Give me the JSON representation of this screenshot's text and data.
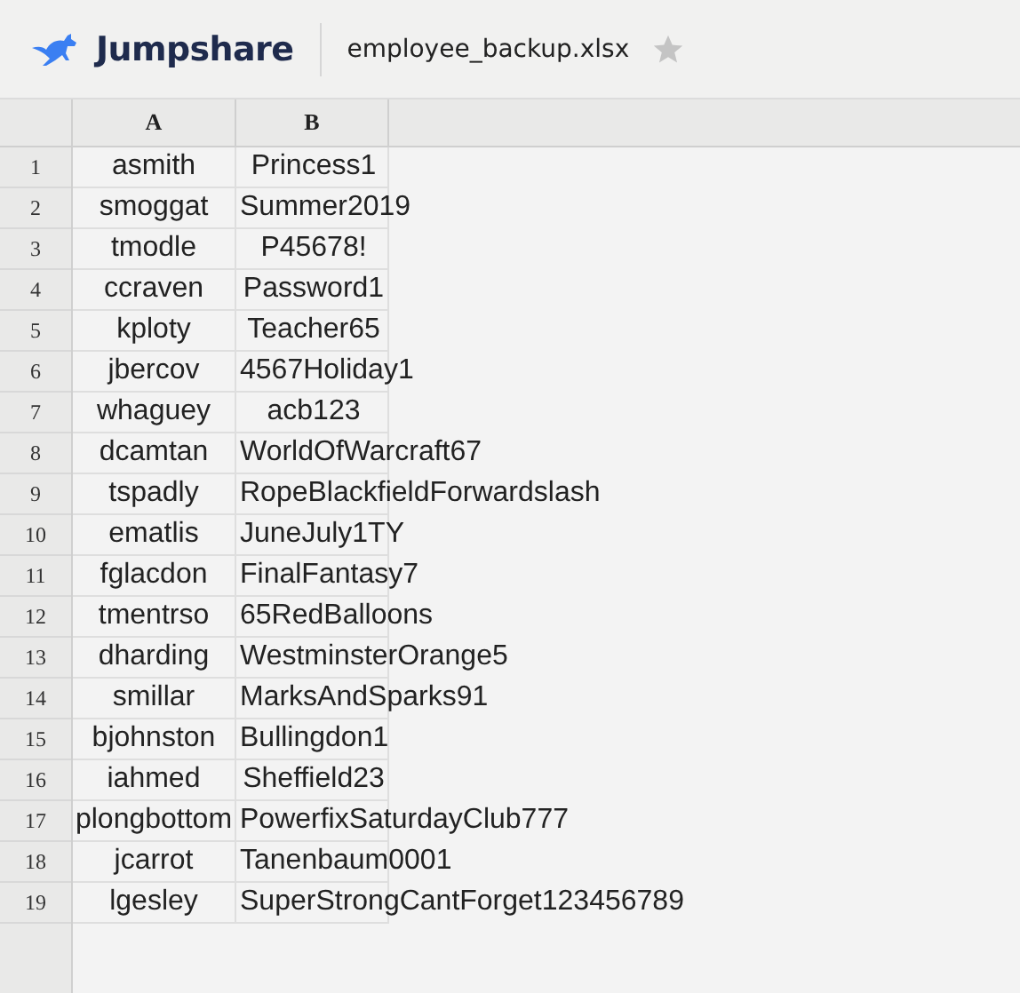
{
  "header": {
    "brand": "Jumpshare",
    "file_name": "employee_backup.xlsx",
    "starred": false
  },
  "sheet": {
    "columns": [
      "A",
      "B"
    ],
    "rows": [
      {
        "number": "1",
        "cells": [
          "asmith",
          "Princess1"
        ]
      },
      {
        "number": "2",
        "cells": [
          "smoggat",
          "Summer2019"
        ]
      },
      {
        "number": "3",
        "cells": [
          "tmodle",
          "P45678!"
        ]
      },
      {
        "number": "4",
        "cells": [
          "ccraven",
          "Password1"
        ]
      },
      {
        "number": "5",
        "cells": [
          "kploty",
          "Teacher65"
        ]
      },
      {
        "number": "6",
        "cells": [
          "jbercov",
          "4567Holiday1"
        ]
      },
      {
        "number": "7",
        "cells": [
          "whaguey",
          "acb123"
        ]
      },
      {
        "number": "8",
        "cells": [
          "dcamtan",
          "WorldOfWarcraft67"
        ]
      },
      {
        "number": "9",
        "cells": [
          "tspadly",
          "RopeBlackfieldForwardslash"
        ]
      },
      {
        "number": "10",
        "cells": [
          "ematlis",
          "JuneJuly1TY"
        ]
      },
      {
        "number": "11",
        "cells": [
          "fglacdon",
          "FinalFantasy7"
        ]
      },
      {
        "number": "12",
        "cells": [
          "tmentrso",
          "65RedBalloons"
        ]
      },
      {
        "number": "13",
        "cells": [
          "dharding",
          "WestminsterOrange5"
        ]
      },
      {
        "number": "14",
        "cells": [
          "smillar",
          "MarksAndSparks91"
        ]
      },
      {
        "number": "15",
        "cells": [
          "bjohnston",
          "Bullingdon1"
        ]
      },
      {
        "number": "16",
        "cells": [
          "iahmed",
          "Sheffield23"
        ]
      },
      {
        "number": "17",
        "cells": [
          "plongbottom",
          "PowerfixSaturdayClub777"
        ]
      },
      {
        "number": "18",
        "cells": [
          "jcarrot",
          "Tanenbaum0001"
        ]
      },
      {
        "number": "19",
        "cells": [
          "lgesley",
          "SuperStrongCantForget123456789"
        ]
      }
    ]
  }
}
